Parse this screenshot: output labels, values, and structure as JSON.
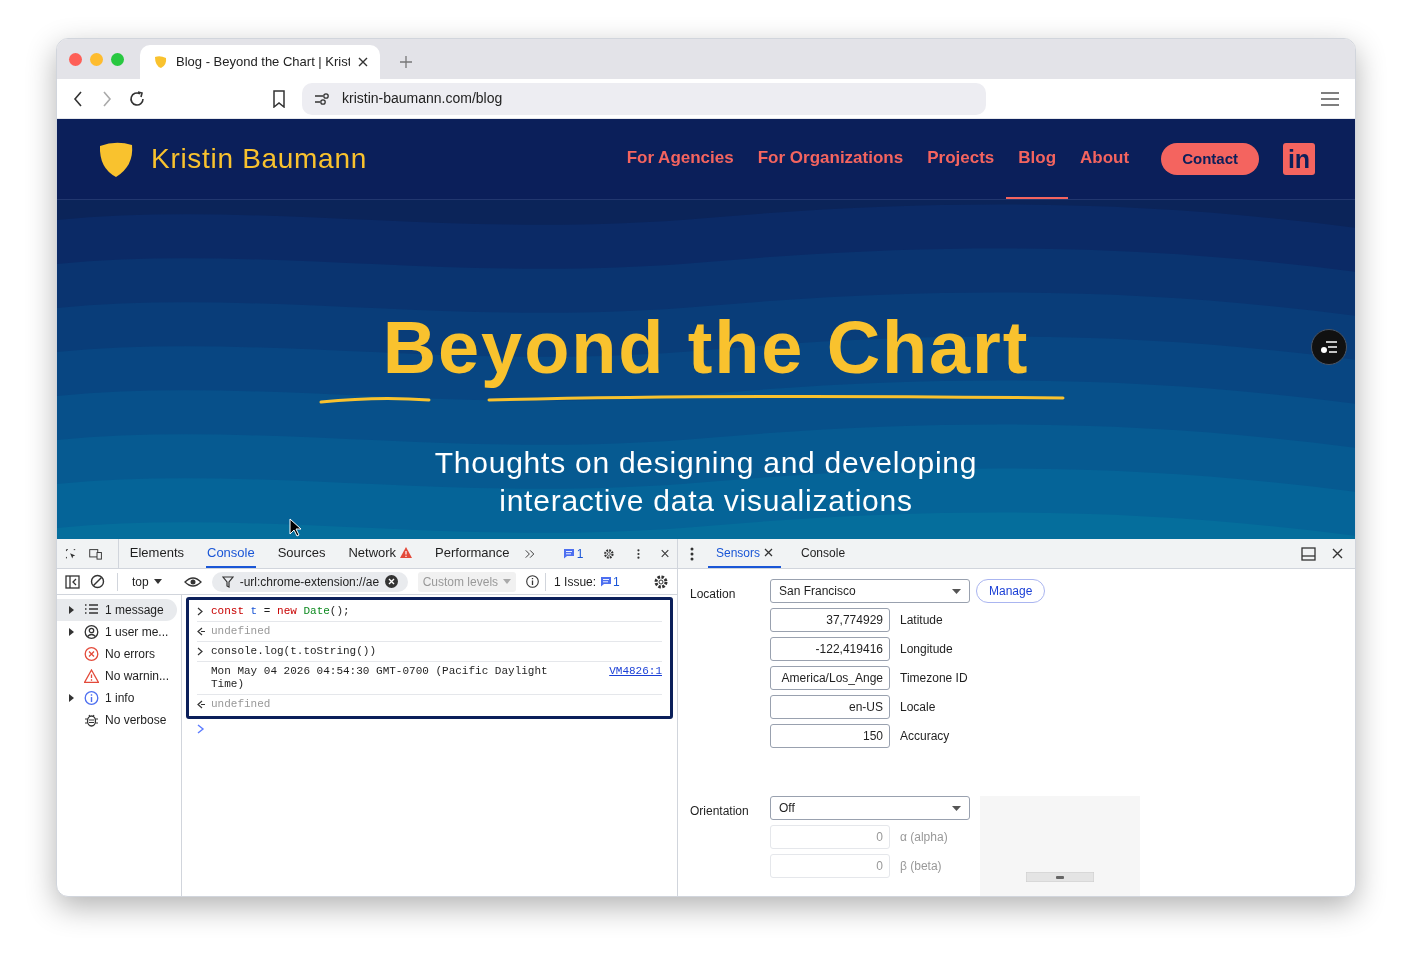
{
  "browser": {
    "tab_title": "Blog - Beyond the Chart | Krist",
    "url": "kristin-baumann.com/blog"
  },
  "site": {
    "brand": "Kristin Baumann",
    "nav": [
      {
        "label": "For Agencies",
        "selected": false
      },
      {
        "label": "For Organizations",
        "selected": false
      },
      {
        "label": "Projects",
        "selected": false
      },
      {
        "label": "Blog",
        "selected": true
      },
      {
        "label": "About",
        "selected": false
      }
    ],
    "contact": "Contact",
    "linkedin": "in",
    "hero": {
      "title": "Beyond the Chart",
      "subtitle": [
        "Thoughts on designing and developing",
        "interactive data visualizations"
      ]
    }
  },
  "devtools": {
    "tabs": [
      {
        "label": "Elements",
        "selected": false,
        "warning": false
      },
      {
        "label": "Console",
        "selected": true,
        "warning": false
      },
      {
        "label": "Sources",
        "selected": false,
        "warning": false
      },
      {
        "label": "Network",
        "selected": false,
        "warning": true
      },
      {
        "label": "Performance",
        "selected": false,
        "warning": false
      }
    ],
    "issues_count": "1",
    "toolbar": {
      "context": "top",
      "filter": "-url:chrome-extension://ae",
      "levels": "Custom levels",
      "issues_label": "1 Issue:",
      "issues_count": "1"
    },
    "sidebar": [
      {
        "label": "1 message",
        "kind": "list",
        "expandable": true,
        "selected": true
      },
      {
        "label": "1 user me...",
        "kind": "user",
        "expandable": true,
        "selected": false
      },
      {
        "label": "No errors",
        "kind": "error",
        "expandable": false,
        "selected": false
      },
      {
        "label": "No warnin...",
        "kind": "warning",
        "expandable": false,
        "selected": false
      },
      {
        "label": "1 info",
        "kind": "info",
        "expandable": true,
        "selected": false
      },
      {
        "label": "No verbose",
        "kind": "verbose",
        "expandable": false,
        "selected": false
      }
    ],
    "console": [
      {
        "kind": "input",
        "tokens": [
          {
            "text": "const",
            "kind": "keyword"
          },
          {
            "text": " t",
            "kind": "variable"
          },
          {
            "text": " = ",
            "kind": "plain"
          },
          {
            "text": "new",
            "kind": "keyword"
          },
          {
            "text": " Date",
            "kind": "function"
          },
          {
            "text": "();",
            "kind": "plain"
          }
        ]
      },
      {
        "kind": "result",
        "tokens": [
          {
            "text": "undefined",
            "kind": "plain"
          }
        ]
      },
      {
        "kind": "input",
        "tokens": [
          {
            "text": "console.log(t.toString())",
            "kind": "plain"
          }
        ]
      },
      {
        "kind": "log",
        "tokens": [
          {
            "text": "Mon May 04 2026 04:54:30 GMT-0700 (Pacific Daylight Time)",
            "kind": "plain"
          }
        ],
        "link": "VM4826:1"
      },
      {
        "kind": "result",
        "tokens": [
          {
            "text": "undefined",
            "kind": "plain"
          }
        ]
      }
    ],
    "drawer": {
      "tabs": [
        {
          "label": "Sensors",
          "selected": true,
          "closable": true
        },
        {
          "label": "Console",
          "selected": false,
          "closable": false
        }
      ],
      "location": {
        "label": "Location",
        "select": "San Francisco",
        "manage": "Manage",
        "fields": [
          {
            "value": "37,774929",
            "label": "Latitude",
            "disabled": false
          },
          {
            "value": "-122,419416",
            "label": "Longitude",
            "disabled": false
          },
          {
            "value": "America/Los_Ange",
            "label": "Timezone ID",
            "disabled": false
          },
          {
            "value": "en-US",
            "label": "Locale",
            "disabled": false
          },
          {
            "value": "150",
            "label": "Accuracy",
            "disabled": false
          }
        ]
      },
      "orientation": {
        "label": "Orientation",
        "select": "Off",
        "fields": [
          {
            "value": "0",
            "label": "α (alpha)",
            "disabled": true
          },
          {
            "value": "0",
            "label": "β (beta)",
            "disabled": true
          }
        ]
      }
    }
  }
}
